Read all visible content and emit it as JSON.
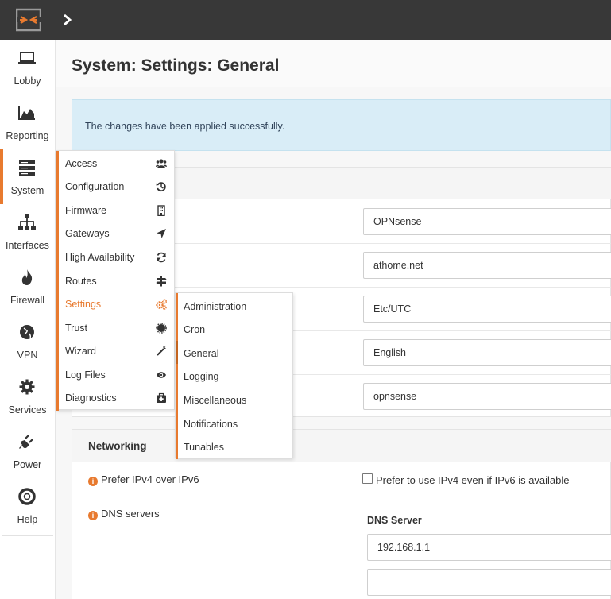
{
  "header": {
    "logo_icon": "opnsense-logo-icon",
    "toggle_icon": "chevron-right-icon"
  },
  "leftnav": {
    "items": [
      {
        "label": "Lobby",
        "icon": "laptop-icon"
      },
      {
        "label": "Reporting",
        "icon": "area-chart-icon"
      },
      {
        "label": "System",
        "icon": "server-icon"
      },
      {
        "label": "Interfaces",
        "icon": "sitemap-icon"
      },
      {
        "label": "Firewall",
        "icon": "fire-icon"
      },
      {
        "label": "VPN",
        "icon": "globe-icon"
      },
      {
        "label": "Services",
        "icon": "gear-icon"
      },
      {
        "label": "Power",
        "icon": "plug-icon"
      },
      {
        "label": "Help",
        "icon": "lifebuoy-icon"
      }
    ]
  },
  "page": {
    "title": "System: Settings: General",
    "alert": "The changes have been applied successfully.",
    "fields": [
      "OPNsense",
      "athome.net",
      "Etc/UTC",
      "English",
      "opnsense"
    ],
    "networking": {
      "title": "Networking",
      "prefer_label": "Prefer IPv4 over IPv6",
      "prefer_checkbox_label": "Prefer to use IPv4 even if IPv6 is available",
      "dns_label": "DNS servers",
      "dns_header": "DNS Server",
      "dns_values": [
        "192.168.1.1",
        ""
      ]
    }
  },
  "menu_system": {
    "items": [
      {
        "label": "Access",
        "icon": "users-icon"
      },
      {
        "label": "Configuration",
        "icon": "history-icon"
      },
      {
        "label": "Firmware",
        "icon": "building-icon"
      },
      {
        "label": "Gateways",
        "icon": "location-arrow-icon"
      },
      {
        "label": "High Availability",
        "icon": "refresh-icon"
      },
      {
        "label": "Routes",
        "icon": "signpost-icon"
      },
      {
        "label": "Settings",
        "icon": "cogs-icon"
      },
      {
        "label": "Trust",
        "icon": "certificate-icon"
      },
      {
        "label": "Wizard",
        "icon": "magic-wand-icon"
      },
      {
        "label": "Log Files",
        "icon": "eye-icon"
      },
      {
        "label": "Diagnostics",
        "icon": "medkit-icon"
      }
    ],
    "selected": "Settings"
  },
  "menu_settings": {
    "items": [
      "Administration",
      "Cron",
      "General",
      "Logging",
      "Miscellaneous",
      "Notifications",
      "Tunables"
    ],
    "selected": "General"
  },
  "colors": {
    "accent": "#e87a2f",
    "topbar": "#383838",
    "alert_bg": "#d9edf7"
  }
}
